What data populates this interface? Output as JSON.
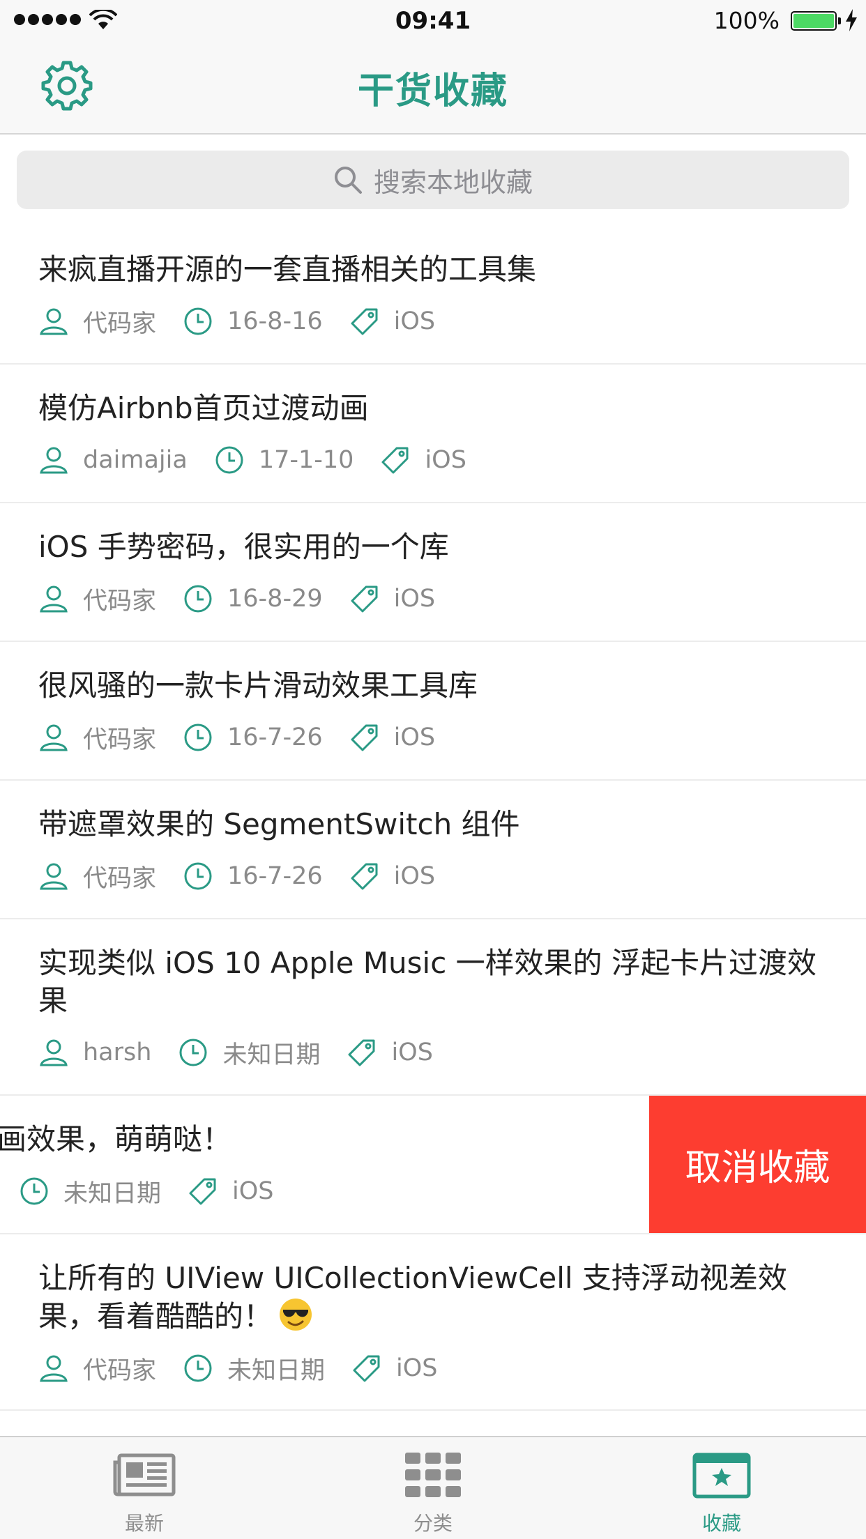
{
  "status_bar": {
    "time": "09:41",
    "battery": "100%"
  },
  "nav": {
    "title": "干货收藏"
  },
  "search": {
    "placeholder": "搜索本地收藏"
  },
  "items": [
    {
      "title": "来疯直播开源的一套直播相关的工具集",
      "author": "代码家",
      "date": "16-8-16",
      "tag": "iOS"
    },
    {
      "title": "模仿Airbnb首页过渡动画",
      "author": "daimajia",
      "date": "17-1-10",
      "tag": "iOS"
    },
    {
      "title": "iOS 手势密码，很实用的一个库",
      "author": "代码家",
      "date": "16-8-29",
      "tag": "iOS"
    },
    {
      "title": "很风骚的一款卡片滑动效果工具库",
      "author": "代码家",
      "date": "16-7-26",
      "tag": "iOS"
    },
    {
      "title": "带遮罩效果的 SegmentSwitch 组件",
      "author": "代码家",
      "date": "16-7-26",
      "tag": "iOS"
    },
    {
      "title": "实现类似 iOS 10 Apple Music 一样效果的 浮起卡片过渡效果",
      "author": "harsh",
      "date": "未知日期",
      "tag": "iOS"
    },
    {
      "title": "加上萌萌哒动画效果，萌萌哒！",
      "author": "",
      "date": "未知日期",
      "tag": "iOS",
      "swipe_action": "取消收藏"
    },
    {
      "title": "让所有的 UIView UICollectionViewCell 支持浮动视差效果，看着酷酷的！",
      "author": "代码家",
      "date": "未知日期",
      "tag": "iOS"
    }
  ],
  "tabs": [
    {
      "label": "最新",
      "icon": "newspaper-icon"
    },
    {
      "label": "分类",
      "icon": "grid-icon"
    },
    {
      "label": "收藏",
      "icon": "star-bookmark-icon",
      "active": true
    }
  ],
  "colors": {
    "accent": "#2a9a85",
    "destructive": "#fd3d30"
  }
}
